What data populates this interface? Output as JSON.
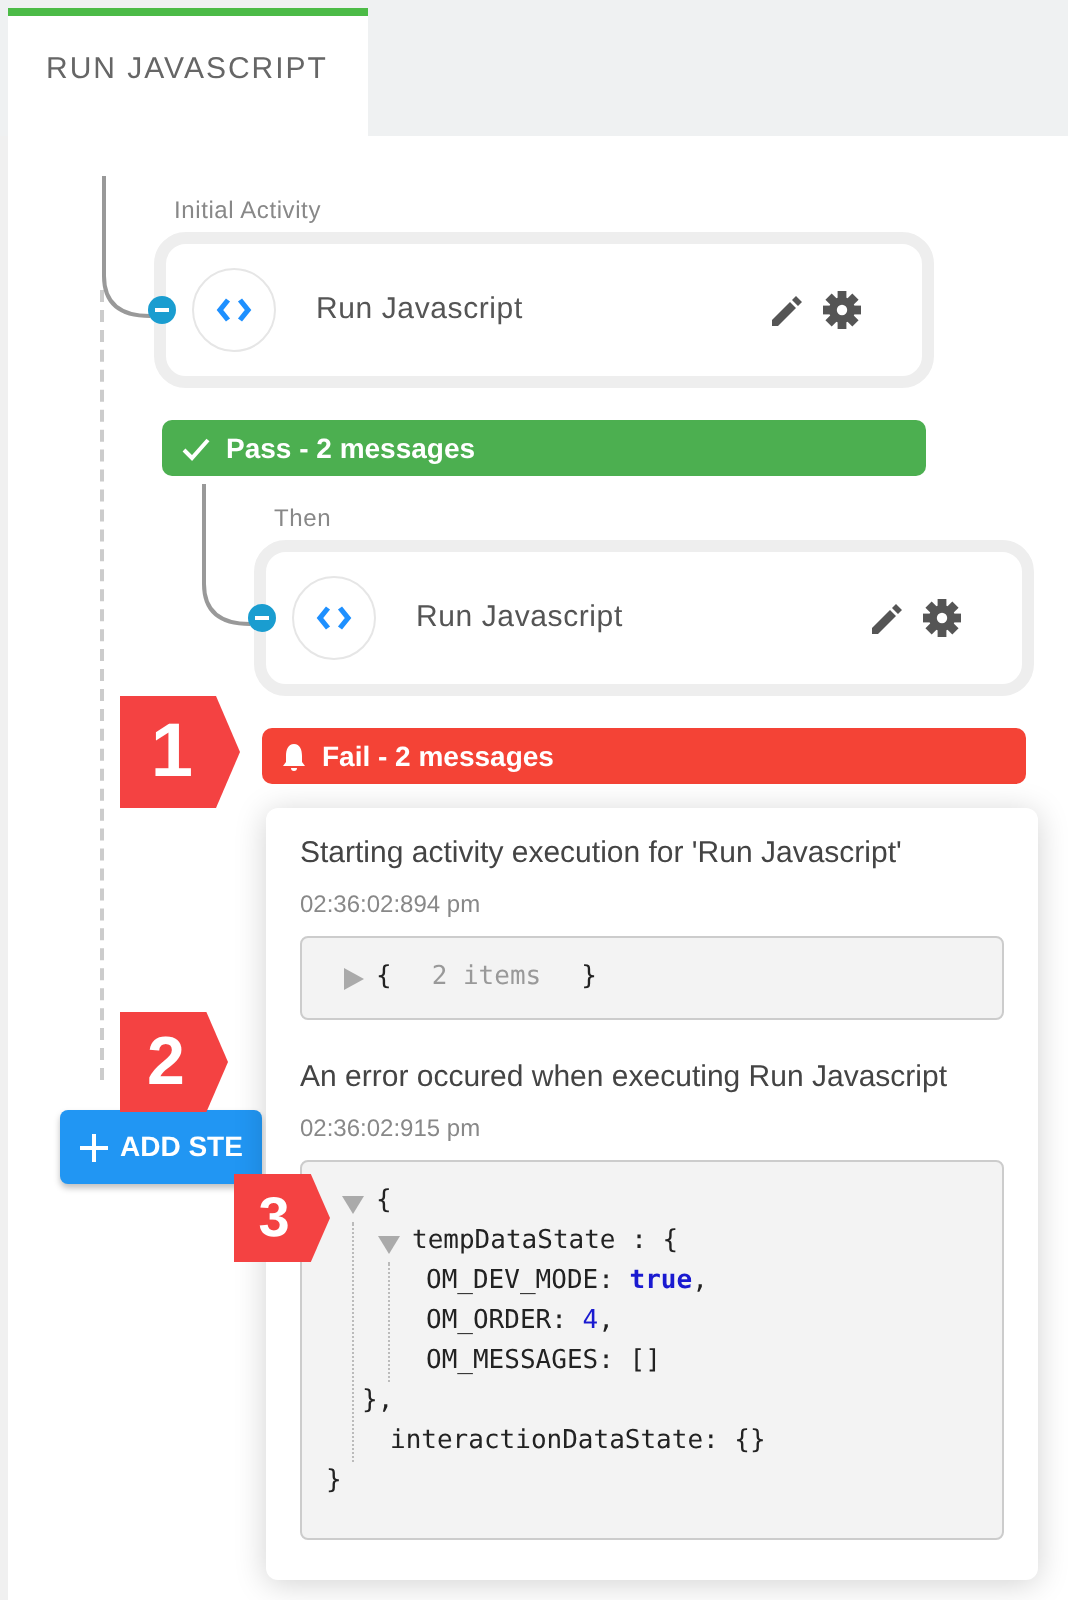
{
  "tab": {
    "label": "RUN JAVASCRIPT",
    "selected": true
  },
  "flow": {
    "caption": "Initial Activity",
    "title": "Run Javascript",
    "result": {
      "kind": "pass",
      "label": "Pass - 2 messages"
    },
    "children": [
      {
        "caption": "Then",
        "title": "Run Javascript",
        "result": {
          "kind": "fail",
          "label": "Fail - 2 messages"
        }
      }
    ]
  },
  "add_step_button": "ADD STE",
  "popover": {
    "messages": [
      {
        "text": "Starting activity execution for 'Run Javascript'",
        "time": "02:36:02:894 pm",
        "data": {
          "expanded": false,
          "open": "{",
          "summary": "2 items",
          "close": "}"
        }
      },
      {
        "text": "An error occured when executing Run Javascript",
        "time": "02:36:02:915 pm",
        "data": {
          "expanded": true,
          "open": "{",
          "close": "}",
          "children": [
            {
              "expanded": true,
              "open": "tempDataState : {",
              "close": "},",
              "children": [
                {
                  "key": "OM_DEV_MODE:",
                  "value": "true",
                  "after": ","
                },
                {
                  "key": "OM_ORDER:",
                  "value": "4",
                  "after": ","
                },
                {
                  "key": "OM_MESSAGES: []"
                }
              ]
            },
            {
              "key": "interactionDataState: {}"
            }
          ]
        }
      }
    ]
  },
  "callouts": [
    "1",
    "2",
    "3"
  ]
}
